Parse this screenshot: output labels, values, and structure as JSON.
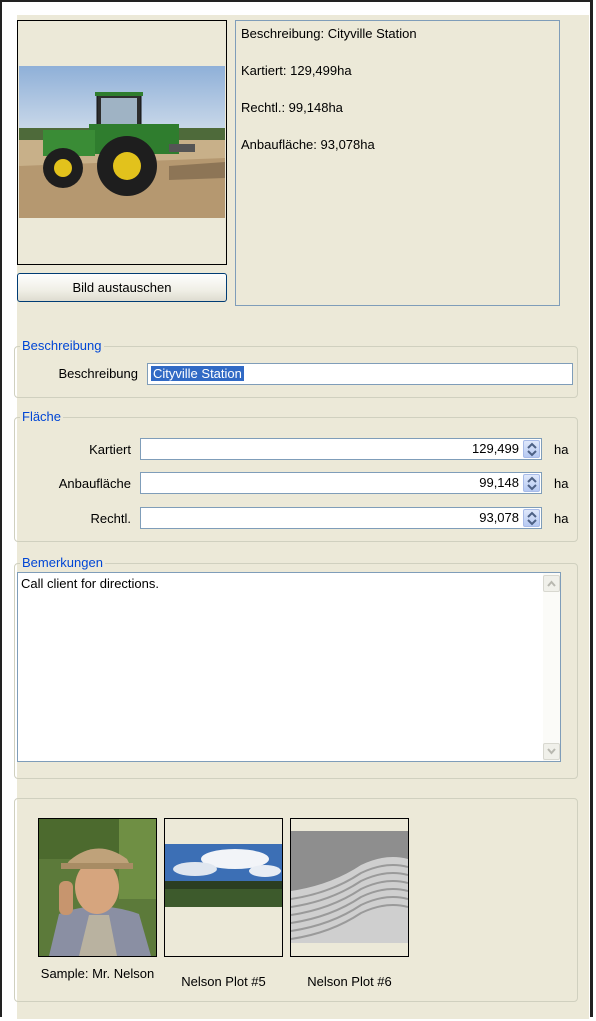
{
  "photo": {
    "change_button": "Bild austauschen"
  },
  "info": {
    "lines": [
      "Beschreibung: Cityville Station",
      "Kartiert: 129,499ha",
      "Rechtl.: 99,148ha",
      "Anbaufläche: 93,078ha"
    ]
  },
  "description_group": {
    "legend": "Beschreibung",
    "label": "Beschreibung",
    "value": "Cityville Station"
  },
  "area_group": {
    "legend": "Fläche",
    "fields": [
      {
        "label": "Kartiert",
        "value": "129,499",
        "unit": "ha"
      },
      {
        "label": "Anbaufläche",
        "value": "99,148",
        "unit": "ha"
      },
      {
        "label": "Rechtl.",
        "value": "93,078",
        "unit": "ha"
      }
    ]
  },
  "remarks_group": {
    "legend": "Bemerkungen",
    "text": "Call client for directions."
  },
  "gallery": {
    "items": [
      {
        "caption": "Sample: Mr. Nelson"
      },
      {
        "caption": "Nelson Plot #5"
      },
      {
        "caption": "Nelson Plot #6"
      }
    ]
  },
  "colors": {
    "legend_text": "#0046d5",
    "panel_bg": "#ece9d8",
    "selection": "#316ac5",
    "field_border": "#7f9db9"
  }
}
